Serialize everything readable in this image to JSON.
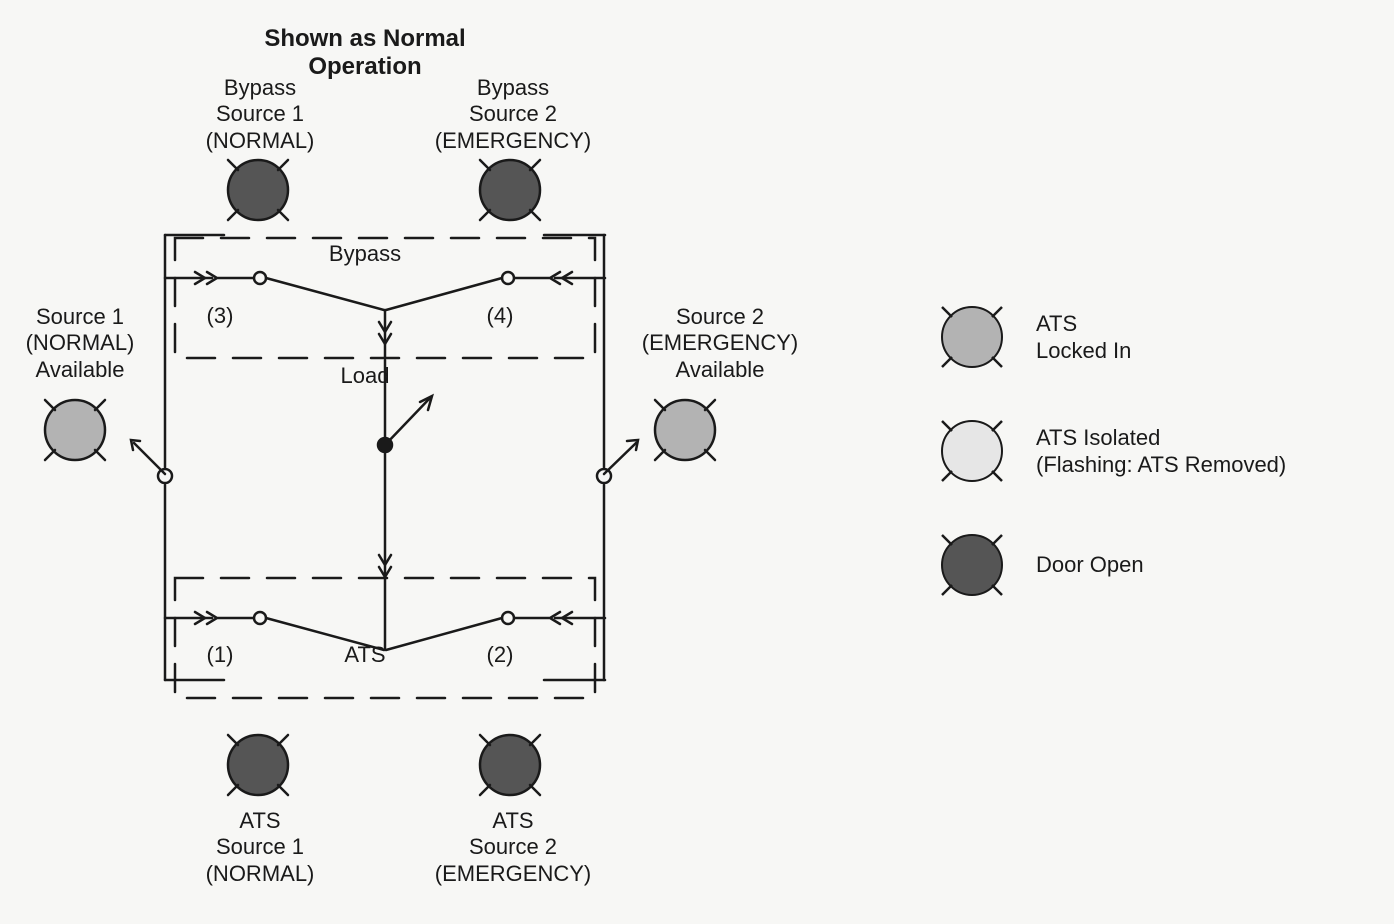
{
  "title": "Shown as Normal Operation",
  "labels": {
    "bypass_source_1": "Bypass\nSource 1\n(NORMAL)",
    "bypass_source_2": "Bypass\nSource 2\n(EMERGENCY)",
    "source_1_available": "Source 1\n(NORMAL)\nAvailable",
    "source_2_available": "Source 2\n(EMERGENCY)\nAvailable",
    "ats_source_1": "ATS\nSource 1\n(NORMAL)",
    "ats_source_2": "ATS\nSource 2\n(EMERGENCY)",
    "bypass": "Bypass",
    "load": "Load",
    "ats": "ATS",
    "n1": "(1)",
    "n2": "(2)",
    "n3": "(3)",
    "n4": "(4)"
  },
  "legend": {
    "locked_in": "ATS\nLocked In",
    "isolated": "ATS Isolated\n(Flashing: ATS Removed)",
    "door_open": "Door Open"
  },
  "colors": {
    "dark": "#555555",
    "medium": "#b3b3b3",
    "light": "#e6e6e6",
    "stroke": "#1a1a1a"
  }
}
